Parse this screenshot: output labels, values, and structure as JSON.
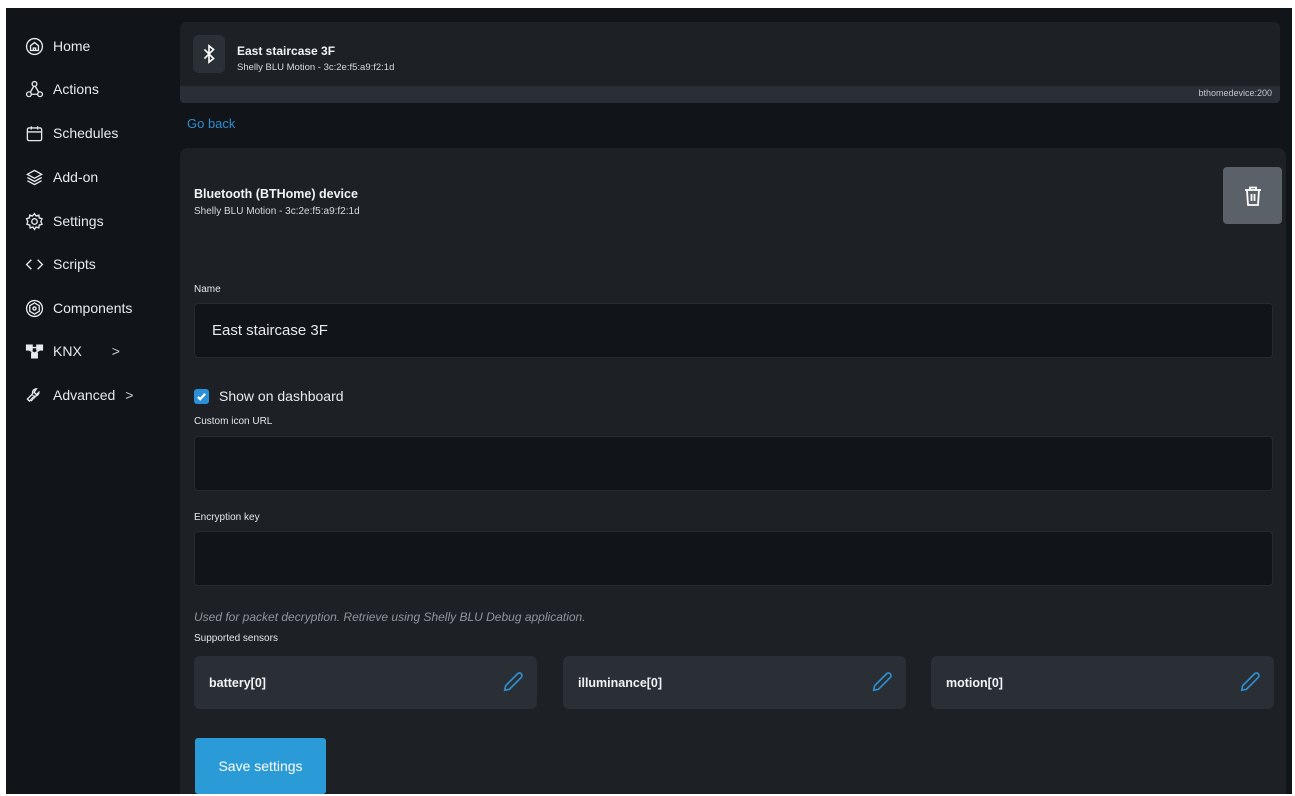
{
  "sidebar": {
    "items": [
      {
        "label": "Home",
        "icon": "home-icon"
      },
      {
        "label": "Actions",
        "icon": "actions-icon"
      },
      {
        "label": "Schedules",
        "icon": "calendar-icon"
      },
      {
        "label": "Add-on",
        "icon": "layers-icon"
      },
      {
        "label": "Settings",
        "icon": "gear-icon"
      },
      {
        "label": "Scripts",
        "icon": "code-icon"
      },
      {
        "label": "Components",
        "icon": "components-icon"
      },
      {
        "label": "KNX",
        "icon": "network-icon",
        "chevron": ">"
      },
      {
        "label": "Advanced",
        "icon": "wrench-icon",
        "chevron": ">"
      }
    ]
  },
  "device_header": {
    "title": "East staircase 3F",
    "subtitle": "Shelly BLU Motion - 3c:2e:f5:a9:f2:1d",
    "component_id": "bthomedevice:200",
    "icon": "bluetooth-icon"
  },
  "go_back": "Go back",
  "card": {
    "title": "Bluetooth (BTHome) device",
    "subtitle": "Shelly BLU Motion - 3c:2e:f5:a9:f2:1d",
    "delete_icon": "trash-icon"
  },
  "form": {
    "name_label": "Name",
    "name_value": "East staircase 3F",
    "show_on_dashboard_label": "Show on dashboard",
    "show_on_dashboard_checked": true,
    "custom_icon_label": "Custom icon URL",
    "custom_icon_value": "",
    "encryption_label": "Encryption key",
    "encryption_value": "",
    "encryption_hint": "Used for packet decryption. Retrieve using Shelly BLU Debug application.",
    "supported_sensors_label": "Supported sensors",
    "sensors": [
      {
        "label": "battery[0]"
      },
      {
        "label": "illuminance[0]"
      },
      {
        "label": "motion[0]"
      }
    ],
    "save_label": "Save settings"
  },
  "colors": {
    "background": "#111418",
    "panel": "#1d2126",
    "accent": "#2a9bd6",
    "link": "#2f8fd0"
  }
}
